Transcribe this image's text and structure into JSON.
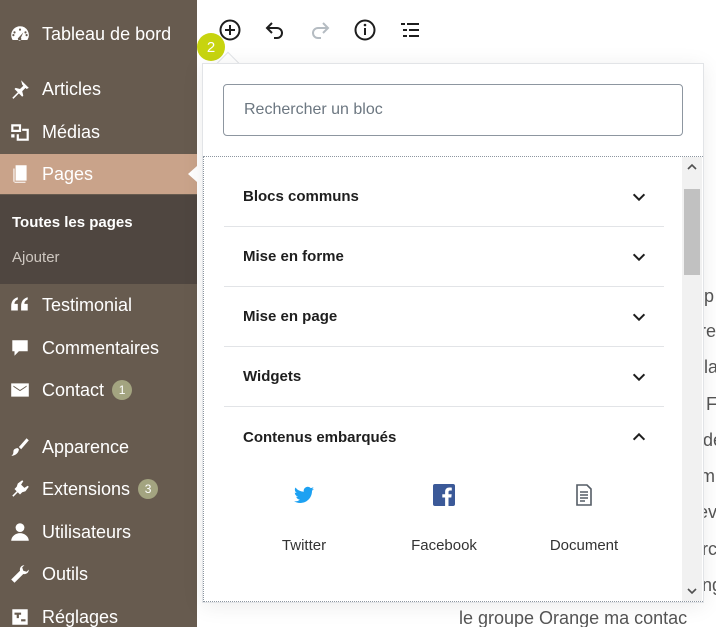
{
  "sidebar": {
    "items": [
      {
        "label": "Tableau de bord",
        "icon": "dashboard-icon"
      },
      {
        "label": "Articles",
        "icon": "pushpin-icon"
      },
      {
        "label": "Médias",
        "icon": "media-icon"
      },
      {
        "label": "Pages",
        "icon": "pages-icon"
      },
      {
        "label": "Testimonial",
        "icon": "quote-icon"
      },
      {
        "label": "Commentaires",
        "icon": "comment-icon"
      },
      {
        "label": "Contact",
        "icon": "mail-icon",
        "badge": "1"
      },
      {
        "label": "Apparence",
        "icon": "paintbrush-icon"
      },
      {
        "label": "Extensions",
        "icon": "plugin-icon",
        "badge": "3"
      },
      {
        "label": "Utilisateurs",
        "icon": "user-icon"
      },
      {
        "label": "Outils",
        "icon": "wrench-icon"
      },
      {
        "label": "Réglages",
        "icon": "settings-icon"
      }
    ],
    "submenu": [
      {
        "label": "Toutes les pages"
      },
      {
        "label": "Ajouter"
      }
    ],
    "colors": {
      "background": "#675b4f",
      "active": "#c9a38a",
      "submenu": "#4f4640",
      "badge": "#a3a480"
    }
  },
  "toolbar": {
    "step_badge": "2",
    "badge_color": "#c7d40f"
  },
  "inserter": {
    "search_placeholder": "Rechercher un bloc",
    "panels": [
      {
        "label": "Blocs communs",
        "expanded": false
      },
      {
        "label": "Mise en forme",
        "expanded": false
      },
      {
        "label": "Mise en page",
        "expanded": false
      },
      {
        "label": "Widgets",
        "expanded": false
      },
      {
        "label": "Contenus embarqués",
        "expanded": true
      }
    ],
    "embed_blocks": [
      {
        "label": "Twitter",
        "icon": "twitter-icon",
        "color": "#1da1f2"
      },
      {
        "label": "Facebook",
        "icon": "facebook-icon",
        "color": "#3b5998"
      },
      {
        "label": "Document",
        "icon": "document-icon",
        "color": "#555d66"
      }
    ]
  },
  "content": {
    "bottom_line": "le groupe Orange ma contac",
    "right_fragments": [
      "p",
      "re",
      "la",
      "F",
      "de",
      "mi",
      "ev",
      "rc",
      "ng"
    ]
  }
}
